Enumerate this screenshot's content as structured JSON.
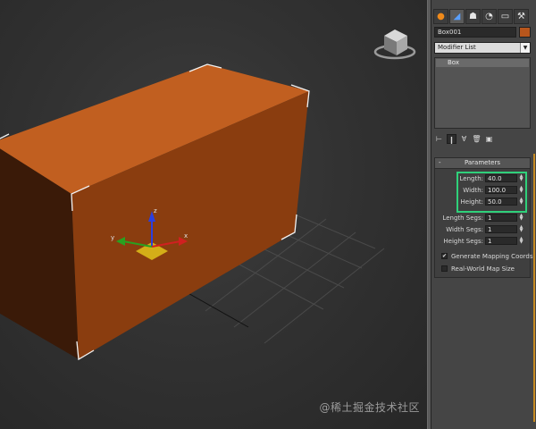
{
  "viewport": {
    "watermark": "@稀土掘金技术社区",
    "viewcube_icon": "viewcube-icon",
    "gizmo_labels": {
      "x": "x",
      "y": "y",
      "z": "z"
    }
  },
  "colors": {
    "object": "#b8561c",
    "highlight": "#2fd07a",
    "viewport_bg": "#363636",
    "panel_bg": "#454545"
  },
  "panel": {
    "tabs": [
      {
        "icon": "create-icon",
        "glyph": "●"
      },
      {
        "icon": "modify-icon",
        "glyph": "◢"
      },
      {
        "icon": "hierarchy-icon",
        "glyph": "☗"
      },
      {
        "icon": "motion-icon",
        "glyph": "◔"
      },
      {
        "icon": "display-icon",
        "glyph": "▭"
      },
      {
        "icon": "utilities-icon",
        "glyph": "⚒"
      }
    ],
    "object_name": "Box001",
    "modifier_list": "Modifier List",
    "stack_items": [
      "Box"
    ],
    "stack_tools": [
      {
        "icon": "pin-stack-icon",
        "glyph": "⊢"
      },
      {
        "icon": "show-end-result-icon",
        "glyph": "❙"
      },
      {
        "icon": "make-unique-icon",
        "glyph": "∀"
      },
      {
        "icon": "remove-modifier-icon",
        "glyph": "🗑"
      },
      {
        "icon": "configure-sets-icon",
        "glyph": "▣"
      }
    ],
    "rollout": {
      "title": "Parameters",
      "toggle": "-",
      "params": [
        {
          "label": "Length:",
          "value": "40.0"
        },
        {
          "label": "Width:",
          "value": "100.0"
        },
        {
          "label": "Height:",
          "value": "50.0"
        },
        {
          "label": "Length Segs:",
          "value": "1"
        },
        {
          "label": "Width Segs:",
          "value": "1"
        },
        {
          "label": "Height Segs:",
          "value": "1"
        }
      ],
      "checkboxes": [
        {
          "label": "Generate Mapping Coords.",
          "checked": "✔"
        },
        {
          "label": "Real-World Map Size",
          "checked": ""
        }
      ]
    }
  }
}
